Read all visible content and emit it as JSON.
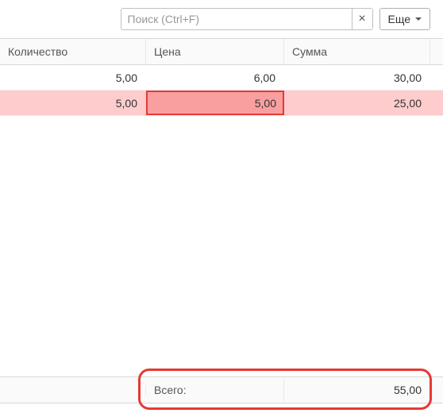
{
  "toolbar": {
    "search_placeholder": "Поиск (Ctrl+F)",
    "search_value": "",
    "clear_label": "×",
    "more_label": "Еще"
  },
  "columns": {
    "qty": "Количество",
    "price": "Цена",
    "sum": "Сумма"
  },
  "rows": [
    {
      "qty": "5,00",
      "price": "6,00",
      "sum": "30,00",
      "highlight": false,
      "price_highlight": false
    },
    {
      "qty": "5,00",
      "price": "5,00",
      "sum": "25,00",
      "highlight": true,
      "price_highlight": true
    }
  ],
  "footer": {
    "label": "Всего:",
    "total": "55,00"
  },
  "icons": {
    "close": "close-icon",
    "caret": "chevron-down-icon"
  },
  "colors": {
    "highlight_border": "#e53935",
    "highlight_row_bg": "#fecccc",
    "highlight_cell_bg": "#f99f9f"
  }
}
